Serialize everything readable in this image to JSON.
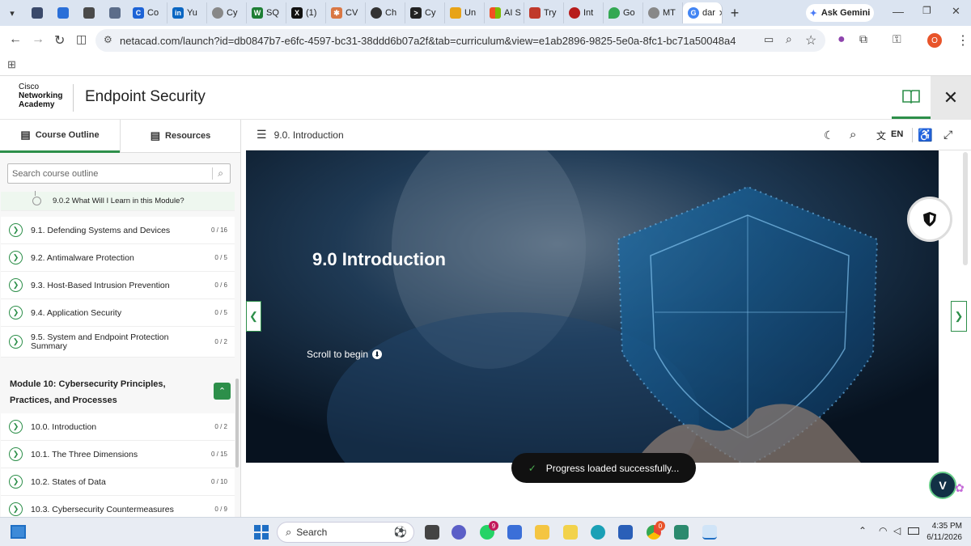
{
  "browser": {
    "tabs": [
      "Co",
      "Yu",
      "Cy",
      "SQ",
      "(1)",
      "CV",
      "Ch",
      "Cy",
      "Un",
      "AI S",
      "Try",
      "Int",
      "Go",
      "MT",
      "dar"
    ],
    "ask_gemini": "Ask Gemini",
    "url": "netacad.com/launch?id=db0847b7-e6fc-4597-bc31-38ddd6b07a2f&tab=curriculum&view=e1ab2896-9825-5e0a-8fc1-bc71a50048a4",
    "profile_initial": "O"
  },
  "app": {
    "logo_line1": "Cisco",
    "logo_line2": "Networking",
    "logo_line3": "Academy",
    "course_title": "Endpoint Security"
  },
  "sidebar": {
    "tab_outline": "Course Outline",
    "tab_resources": "Resources",
    "search_placeholder": "Search course outline",
    "sub_item": "9.0.2 What Will I Learn in this Module?",
    "items": [
      {
        "label": "9.1. Defending Systems and Devices",
        "count": "0 / 16"
      },
      {
        "label": "9.2. Antimalware Protection",
        "count": "0 / 5"
      },
      {
        "label": "9.3. Host-Based Intrusion Prevention",
        "count": "0 / 6"
      },
      {
        "label": "9.4. Application Security",
        "count": "0 / 5"
      },
      {
        "label": "9.5. System and Endpoint Protection Summary",
        "count": "0 / 2"
      }
    ],
    "module_title": "Module 10: Cybersecurity Principles, Practices, and Processes",
    "module_items": [
      {
        "label": "10.0. Introduction",
        "count": "0 / 2"
      },
      {
        "label": "10.1. The Three Dimensions",
        "count": "0 / 15"
      },
      {
        "label": "10.2. States of Data",
        "count": "0 / 10"
      },
      {
        "label": "10.3. Cybersecurity Countermeasures",
        "count": "0 / 9"
      }
    ]
  },
  "content": {
    "breadcrumb": "9.0. Introduction",
    "language": "EN",
    "hero_title": "9.0 Introduction",
    "scroll_label": "Scroll to begin",
    "toast": "Progress loaded successfully..."
  },
  "taskbar": {
    "search": "Search",
    "time": "4:35 PM",
    "date": "6/11/2026",
    "whatsapp_badge": "9",
    "chrome_badge": "0"
  },
  "colors": {
    "accent_green": "#2d8f4a",
    "tabbar_bg": "#dbe4f1",
    "hero_bg": "#0a1e33"
  }
}
